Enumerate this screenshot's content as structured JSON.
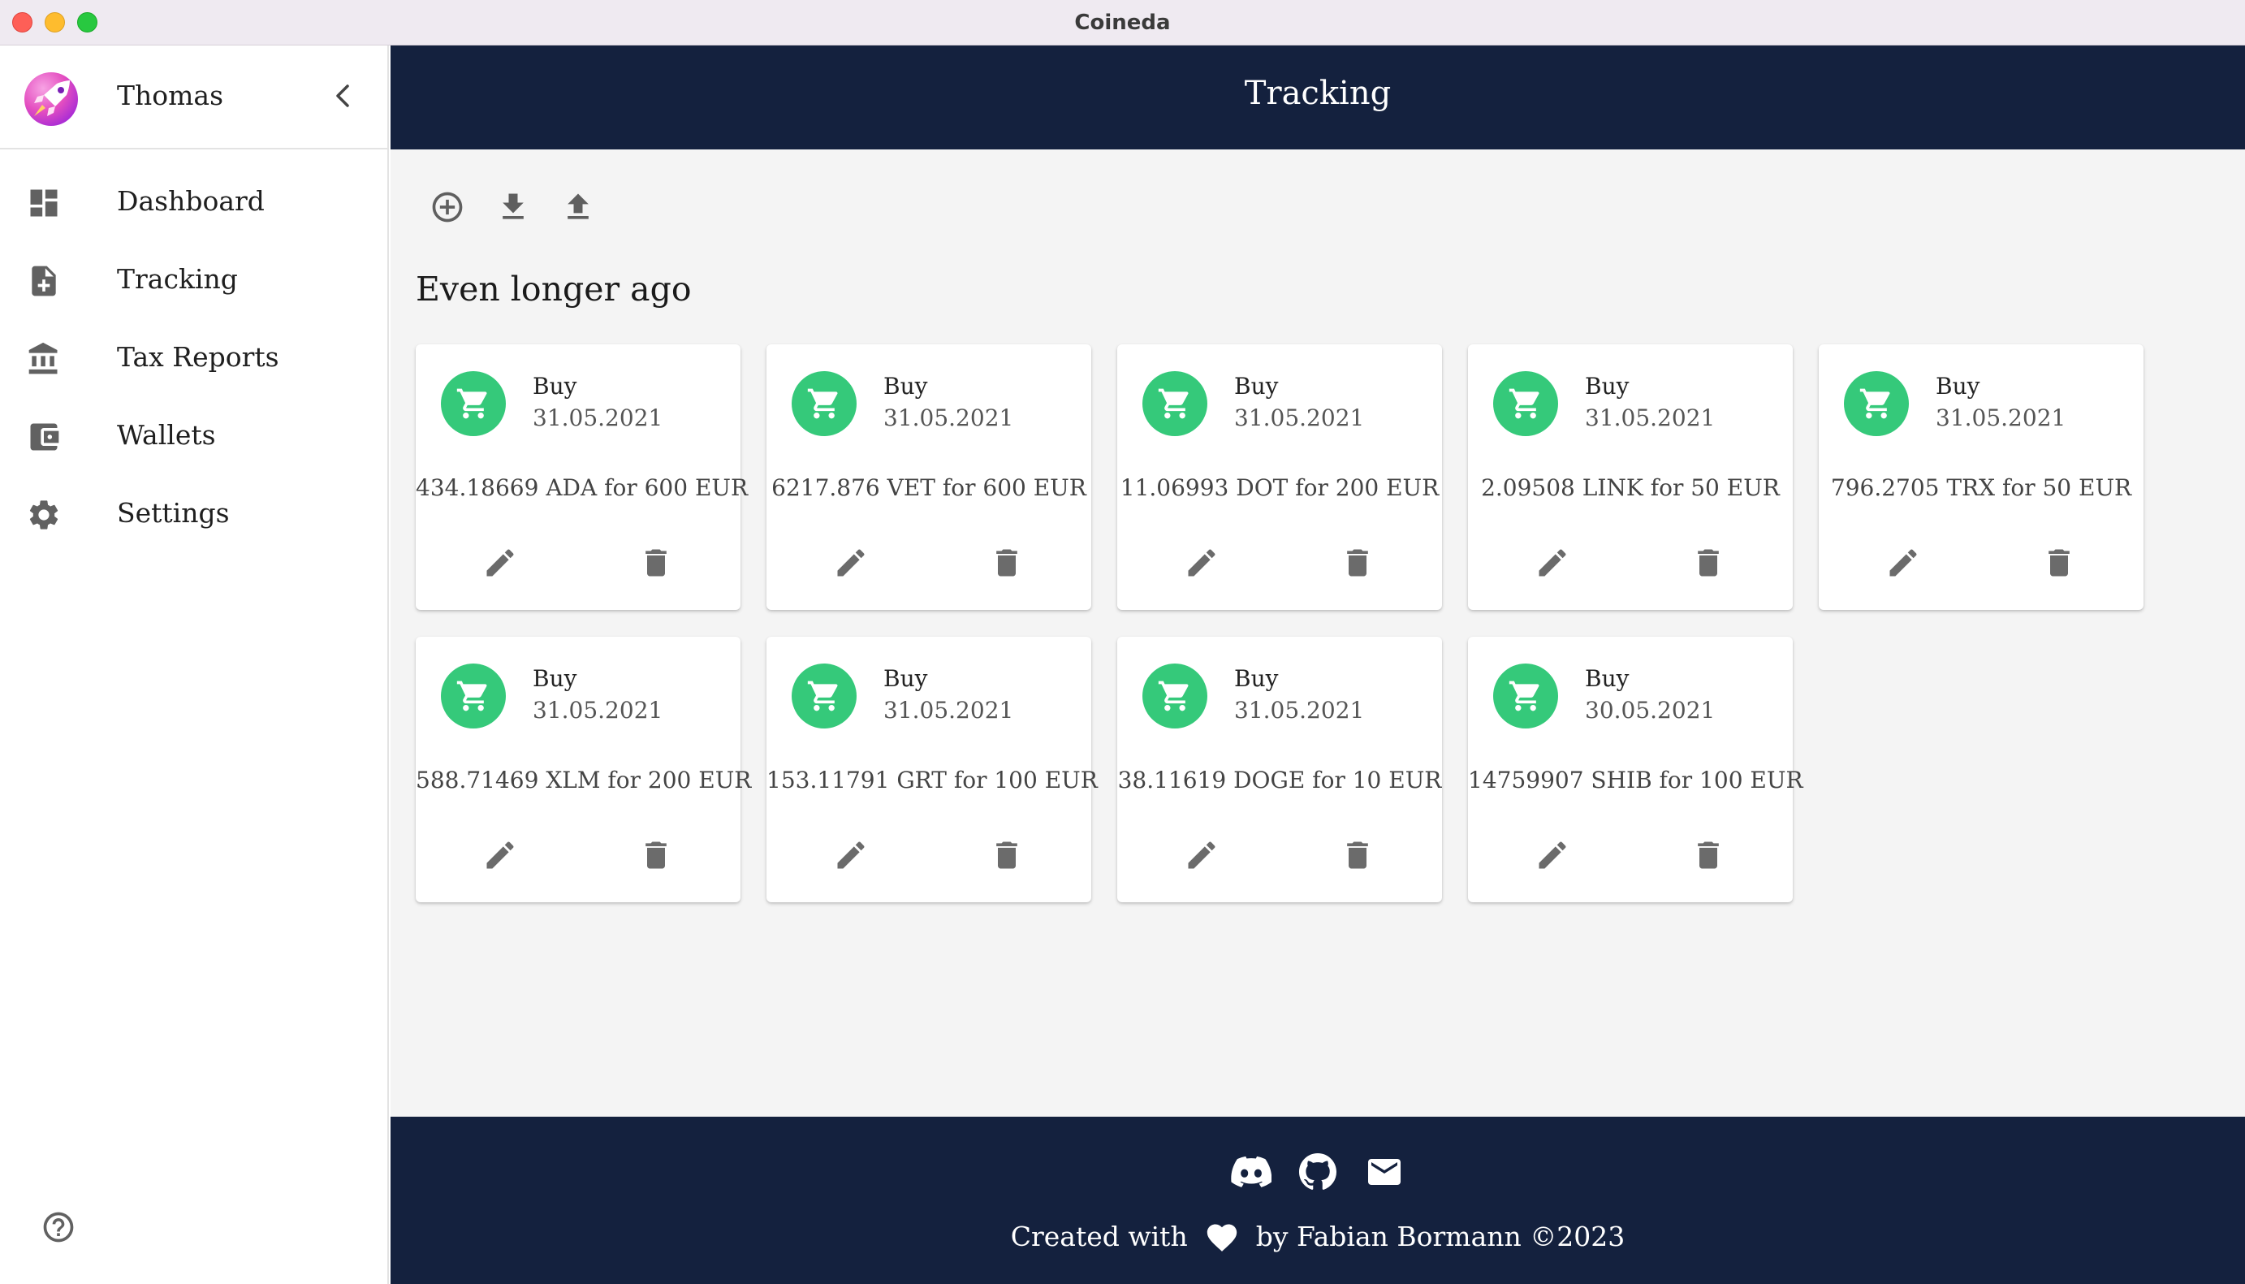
{
  "window": {
    "title": "Coineda"
  },
  "sidebar": {
    "user": {
      "name": "Thomas"
    },
    "items": [
      {
        "label": "Dashboard",
        "icon": "dashboard-icon"
      },
      {
        "label": "Tracking",
        "icon": "note-add-icon"
      },
      {
        "label": "Tax Reports",
        "icon": "bank-icon"
      },
      {
        "label": "Wallets",
        "icon": "wallet-icon"
      },
      {
        "label": "Settings",
        "icon": "gear-icon"
      }
    ],
    "help_icon": "help-icon"
  },
  "header": {
    "title": "Tracking"
  },
  "toolbar": {
    "icons": [
      "add-circle-icon",
      "download-icon",
      "upload-icon"
    ]
  },
  "section": {
    "title": "Even longer ago"
  },
  "transactions": [
    {
      "type": "Buy",
      "date": "31.05.2021",
      "description": "434.18669 ADA for 600 EUR"
    },
    {
      "type": "Buy",
      "date": "31.05.2021",
      "description": "6217.876 VET for 600 EUR"
    },
    {
      "type": "Buy",
      "date": "31.05.2021",
      "description": "11.06993 DOT for 200 EUR"
    },
    {
      "type": "Buy",
      "date": "31.05.2021",
      "description": "2.09508 LINK for 50 EUR"
    },
    {
      "type": "Buy",
      "date": "31.05.2021",
      "description": "796.2705 TRX for 50 EUR"
    },
    {
      "type": "Buy",
      "date": "31.05.2021",
      "description": "588.71469 XLM for 200 EUR"
    },
    {
      "type": "Buy",
      "date": "31.05.2021",
      "description": "153.11791 GRT for 100 EUR"
    },
    {
      "type": "Buy",
      "date": "31.05.2021",
      "description": "38.11619 DOGE for 10 EUR"
    },
    {
      "type": "Buy",
      "date": "30.05.2021",
      "description": "14759907 SHIB for 100 EUR"
    }
  ],
  "footer": {
    "icons": [
      "discord-icon",
      "github-icon",
      "mail-icon"
    ],
    "credit_prefix": "Created with",
    "credit_suffix": "by Fabian Bormann ©2023"
  },
  "colors": {
    "navy": "#14213e",
    "buy_green": "#35c97a",
    "background": "#f4f4f4"
  }
}
